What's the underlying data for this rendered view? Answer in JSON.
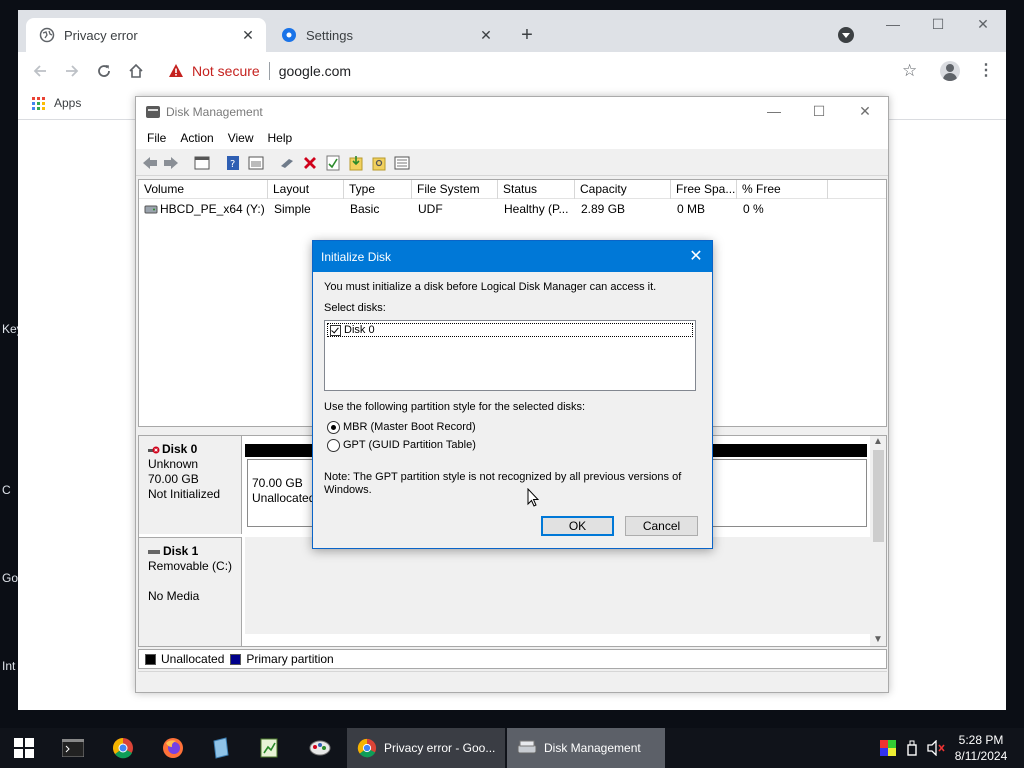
{
  "desktop": {
    "labels": [
      "Key",
      "C",
      "Go",
      "Int"
    ]
  },
  "browser": {
    "tabs": [
      {
        "title": "Privacy error",
        "active": true
      },
      {
        "title": "Settings",
        "active": false
      }
    ],
    "new_tab": "+",
    "security_label": "Not secure",
    "url": "google.com",
    "bookmarks": {
      "apps_label": "Apps"
    },
    "colors": {
      "warning": "#c5221f",
      "tabstrip": "#dee1e6"
    }
  },
  "disk_management": {
    "title": "Disk Management",
    "menu": [
      "File",
      "Action",
      "View",
      "Help"
    ],
    "volume_table": {
      "columns": [
        "Volume",
        "Layout",
        "Type",
        "File System",
        "Status",
        "Capacity",
        "Free Spa...",
        "% Free"
      ],
      "rows": [
        [
          "HBCD_PE_x64 (Y:)",
          "Simple",
          "Basic",
          "UDF",
          "Healthy (P...",
          "2.89 GB",
          "0 MB",
          "0 %"
        ]
      ]
    },
    "disks": [
      {
        "name": "Disk 0",
        "type": "Unknown",
        "size": "70.00 GB",
        "state": "Not Initialized",
        "partition": {
          "size": "70.00 GB",
          "label": "Unallocated"
        }
      },
      {
        "name": "Disk 1",
        "type": "Removable (C:)",
        "size": "",
        "state": "No Media"
      }
    ],
    "legend": [
      {
        "label": "Unallocated",
        "color": "#000000"
      },
      {
        "label": "Primary partition",
        "color": "#00008b"
      }
    ]
  },
  "dialog": {
    "title": "Initialize Disk",
    "message": "You must initialize a disk before Logical Disk Manager can access it.",
    "select_label": "Select disks:",
    "disks": [
      {
        "label": "Disk 0",
        "checked": true
      }
    ],
    "partition_style_label": "Use the following partition style for the selected disks:",
    "options": [
      {
        "label": "MBR (Master Boot Record)",
        "selected": true
      },
      {
        "label": "GPT (GUID Partition Table)",
        "selected": false
      }
    ],
    "note_line1": "Note: The GPT partition style is not recognized by all previous versions of",
    "note_line2": "Windows.",
    "ok": "OK",
    "cancel": "Cancel",
    "accent": "#0078d7"
  },
  "taskbar": {
    "pinned": [
      "start-icon",
      "terminal-icon",
      "chrome-icon",
      "firefox-icon",
      "notepad-icon",
      "spreadsheet-icon",
      "paint-icon"
    ],
    "tasks": [
      {
        "label": "Privacy error - Goo...",
        "icon": "chrome-icon"
      },
      {
        "label": "Disk Management",
        "icon": "disk-management-icon"
      }
    ],
    "time": "5:28 PM",
    "date": "8/11/2024"
  }
}
